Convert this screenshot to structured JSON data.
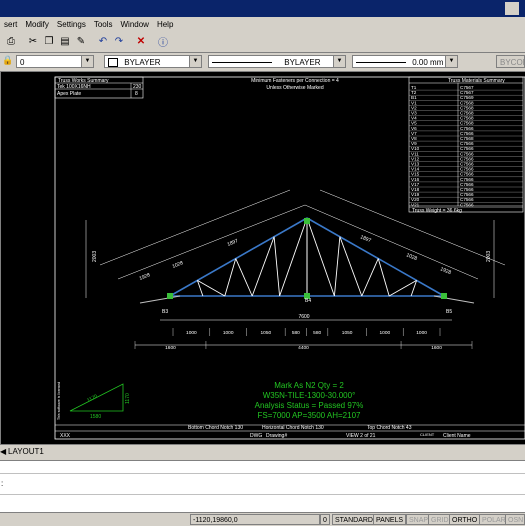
{
  "menu": {
    "items": [
      "sert",
      "Modify",
      "Settings",
      "Tools",
      "Window",
      "Help"
    ]
  },
  "toolbar": {
    "layer_value": "0",
    "color_value": "BYLAYER",
    "linetype_value": "BYLAYER",
    "lineweight_value": "0.00 mm",
    "plotstyle_value": "BYCOLOR"
  },
  "drawing": {
    "truss_works": {
      "title": "Truss Works Summary",
      "rows": [
        {
          "label": "Tek 100X16NH",
          "value": "230"
        },
        {
          "label": "Apex Plate",
          "value": "8"
        }
      ]
    },
    "fasteners_note": [
      "Minimum Fasteners per Connection = 4",
      "Unless Otherwise Marked"
    ],
    "materials": {
      "title": "Truss Materials Summary",
      "members": [
        "T1",
        "T2",
        "B1",
        "V1",
        "V2",
        "V3",
        "V4",
        "V5",
        "V6",
        "V7",
        "V8",
        "V9",
        "V10",
        "V11",
        "V12",
        "V13",
        "V14",
        "V15",
        "V16",
        "V17",
        "V18",
        "V19",
        "V20",
        "V21"
      ],
      "sections": [
        "C7567",
        "C7567",
        "C7569",
        "C7568",
        "C7568",
        "C7568",
        "C7568",
        "C7568",
        "C7566",
        "C7566",
        "C7568",
        "C7566",
        "C7566",
        "C7566",
        "C7566",
        "C7566",
        "C7566",
        "C7566",
        "C7566",
        "C7566",
        "C7566",
        "C7566",
        "C7566",
        "C7566"
      ],
      "weight": "Truss Weight = 36.6kg"
    },
    "dim_top": [
      "1928",
      "1028",
      "1897",
      "1897",
      "1028",
      "1928"
    ],
    "overall_span": "7600",
    "web_spacing": [
      "1000",
      "1000",
      "1050",
      "580",
      "580",
      "1050",
      "1000",
      "1000"
    ],
    "overall_dims": [
      "1600",
      "4400",
      "1600"
    ],
    "chord_labels": {
      "bottom": "B4",
      "left_heel": "B3",
      "right_heel": "B5"
    },
    "height_left": "2003",
    "height_right": "2003",
    "mark": "Mark As N2  Qty = 2",
    "type_line": "W35N-TILE-1300-30.000°",
    "analysis_status": "Analysis Status = Passed 97%",
    "loads_line": "FS=7000  AP=3500  AH=2107",
    "pitch_triangle": {
      "horizontal": "1580",
      "vertical": "1170"
    },
    "footer": {
      "bottom_chord": "Bottom Chord Notch 130",
      "horizontal_chord": "Horizontal Chord Notch 130",
      "top_chord": "Top Chord Notch 43",
      "job": "XXX",
      "dwg": "DWG",
      "drawing": "Drawing#",
      "sheet": "VIEW 2 of 21",
      "client_label": "CLIENT",
      "client_name": "Client Name",
      "software_note": "This software is licensed"
    }
  },
  "tabs": {
    "layout1": "LAYOUT1"
  },
  "command": {
    "prompt": ":"
  },
  "status": {
    "coords": "-1120,19860,0",
    "zero": "0",
    "standard": "STANDARD",
    "panels": "PANELS",
    "snap": "SNAP",
    "grid": "GRID",
    "ortho": "ORTHO",
    "polar": "POLAR",
    "osnap": "OSN"
  }
}
